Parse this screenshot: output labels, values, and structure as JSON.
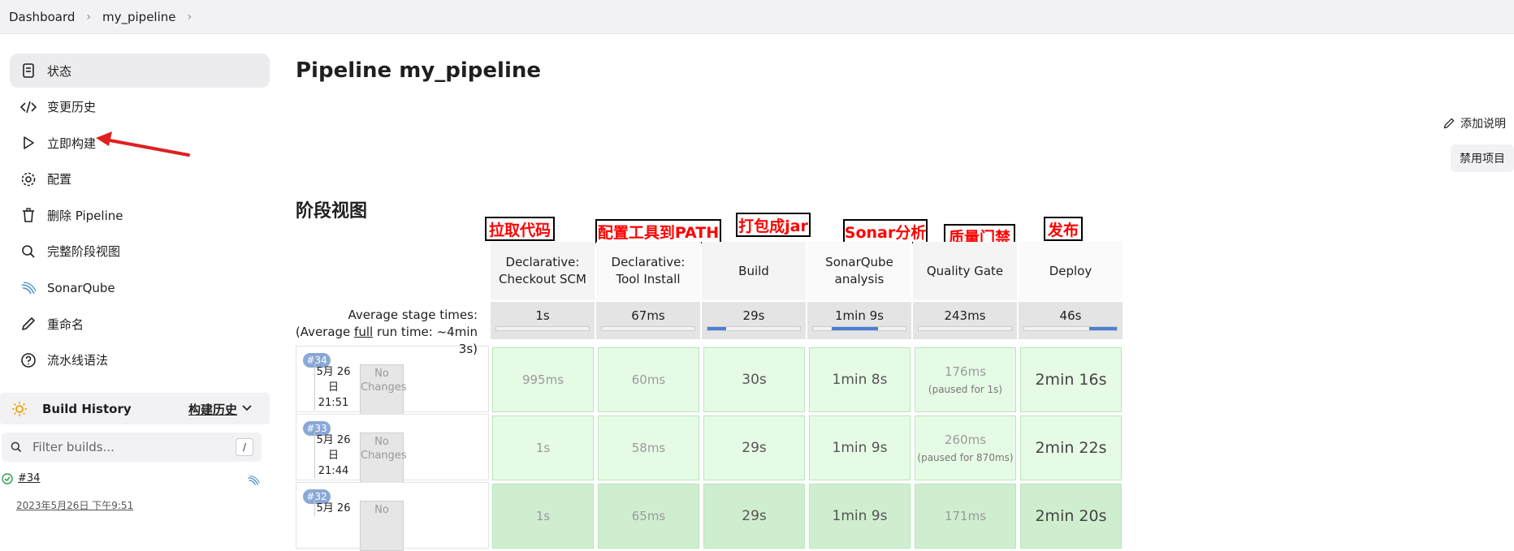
{
  "breadcrumb": [
    "Dashboard",
    "my_pipeline"
  ],
  "sidebar": {
    "items": [
      {
        "label": "状态",
        "icon": "document-icon"
      },
      {
        "label": "变更历史",
        "icon": "code-icon"
      },
      {
        "label": "立即构建",
        "icon": "play-icon"
      },
      {
        "label": "配置",
        "icon": "gear-icon"
      },
      {
        "label": "删除 Pipeline",
        "icon": "trash-icon"
      },
      {
        "label": "完整阶段视图",
        "icon": "search-icon"
      },
      {
        "label": "SonarQube",
        "icon": "sonarqube-icon"
      },
      {
        "label": "重命名",
        "icon": "pencil-icon"
      },
      {
        "label": "流水线语法",
        "icon": "help-icon"
      }
    ]
  },
  "build_history": {
    "title": "Build History",
    "title_cn": "构建历史",
    "filter_placeholder": "Filter builds...",
    "shortcut": "/",
    "latest": {
      "number": "#34",
      "date": "2023年5月26日 下午9:51"
    }
  },
  "main": {
    "title": "Pipeline my_pipeline",
    "add_description": "添加说明",
    "disable_project": "禁用项目",
    "stage_view_title": "阶段视图"
  },
  "annotations": [
    "拉取代码",
    "配置工具到PATH",
    "打包成jar",
    "Sonar分析",
    "质量门禁",
    "发布"
  ],
  "stage_view": {
    "stages": [
      {
        "name_lines": [
          "Declarative:",
          "Checkout SCM"
        ],
        "avg": "1s",
        "fill_start": 0,
        "fill_end": 0
      },
      {
        "name_lines": [
          "Declarative:",
          "Tool Install"
        ],
        "avg": "67ms",
        "fill_start": 0,
        "fill_end": 0
      },
      {
        "name_lines": [
          "Build"
        ],
        "avg": "29s",
        "fill_start": 0,
        "fill_end": 0.2
      },
      {
        "name_lines": [
          "SonarQube",
          "analysis"
        ],
        "avg": "1min 9s",
        "fill_start": 0.2,
        "fill_end": 0.7
      },
      {
        "name_lines": [
          "Quality Gate"
        ],
        "avg": "243ms",
        "fill_start": 0.7,
        "fill_end": 0.7
      },
      {
        "name_lines": [
          "Deploy"
        ],
        "avg": "46s",
        "fill_start": 0.7,
        "fill_end": 1
      }
    ],
    "avg_label": {
      "line1": "Average stage times:",
      "line2_prefix": "(Average ",
      "line2_link": "full",
      "line2_suffix": " run time: ~4min",
      "line3": "3s)"
    },
    "runs": [
      {
        "badge": "#34",
        "date_lines": [
          "5月 26",
          "日",
          "21:51"
        ],
        "changes": "No Changes",
        "cells": [
          {
            "value": "995ms",
            "size": "small"
          },
          {
            "value": "60ms",
            "size": "small"
          },
          {
            "value": "30s",
            "size": "mid"
          },
          {
            "value": "1min 8s",
            "size": "mid"
          },
          {
            "value": "176ms",
            "size": "small",
            "sub": "(paused for 1s)"
          },
          {
            "value": "2min 16s",
            "size": "big"
          }
        ]
      },
      {
        "badge": "#33",
        "date_lines": [
          "5月 26",
          "日",
          "21:44"
        ],
        "changes": "No Changes",
        "cells": [
          {
            "value": "1s",
            "size": "small"
          },
          {
            "value": "58ms",
            "size": "small"
          },
          {
            "value": "29s",
            "size": "mid"
          },
          {
            "value": "1min 9s",
            "size": "mid"
          },
          {
            "value": "260ms",
            "size": "small",
            "sub": "(paused for 870ms)"
          },
          {
            "value": "2min 22s",
            "size": "big"
          }
        ]
      },
      {
        "badge": "#32",
        "date_lines": [
          "5月 26"
        ],
        "changes": "No",
        "cells": [
          {
            "value": "1s",
            "size": "small"
          },
          {
            "value": "65ms",
            "size": "small"
          },
          {
            "value": "29s",
            "size": "mid"
          },
          {
            "value": "1min 9s",
            "size": "mid"
          },
          {
            "value": "171ms",
            "size": "small"
          },
          {
            "value": "2min 20s",
            "size": "big"
          }
        ]
      }
    ]
  }
}
